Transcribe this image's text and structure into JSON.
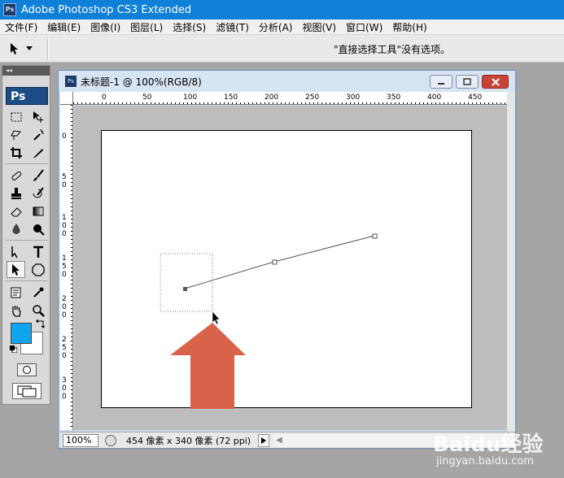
{
  "window": {
    "title": "Adobe Photoshop CS3 Extended",
    "logo": "Ps"
  },
  "menu": [
    "文件(F)",
    "编辑(E)",
    "图像(I)",
    "图层(L)",
    "选择(S)",
    "滤镜(T)",
    "分析(A)",
    "视图(V)",
    "窗口(W)",
    "帮助(H)"
  ],
  "options_bar": {
    "hint": "\"直接选择工具\"没有选项。"
  },
  "toolbox": {
    "badge": "Ps",
    "tools": [
      [
        "marquee-icon",
        "move-icon"
      ],
      [
        "lasso-icon",
        "magic-wand-icon"
      ],
      [
        "crop-icon",
        "slice-icon"
      ],
      [
        "healing-brush-icon",
        "brush-icon"
      ],
      [
        "clone-stamp-icon",
        "history-brush-icon"
      ],
      [
        "eraser-icon",
        "gradient-icon"
      ],
      [
        "blur-icon",
        "dodge-icon"
      ],
      [
        "path-selection-icon",
        "type-icon"
      ],
      [
        "direct-selection-icon",
        "shape-icon"
      ],
      [
        "notes-icon",
        "eyedropper-icon"
      ],
      [
        "hand-icon",
        "zoom-icon"
      ]
    ],
    "selected_tool": "direct-selection-icon",
    "foreground_color": "#0ea5ee",
    "background_color": "#ffffff"
  },
  "document": {
    "title": "未标题-1 @ 100%(RGB/8)",
    "icon": "Ps",
    "ruler_top_labels": [
      "0",
      "50",
      "100",
      "150",
      "200",
      "250",
      "300",
      "350",
      "400",
      "450"
    ],
    "ruler_left_labels": [
      "0",
      "5\n0",
      "1\n0\n0",
      "1\n5\n0",
      "2\n0\n0",
      "2\n5\n0",
      "3\n0\n0"
    ],
    "status": {
      "zoom": "100%",
      "info": "454 像素 x 340 像素 (72 ppi)"
    }
  },
  "annotation": {
    "arrow_color": "#d9634a"
  },
  "watermark": {
    "logo": "Baidu经验",
    "url": "jingyan.baidu.com"
  }
}
